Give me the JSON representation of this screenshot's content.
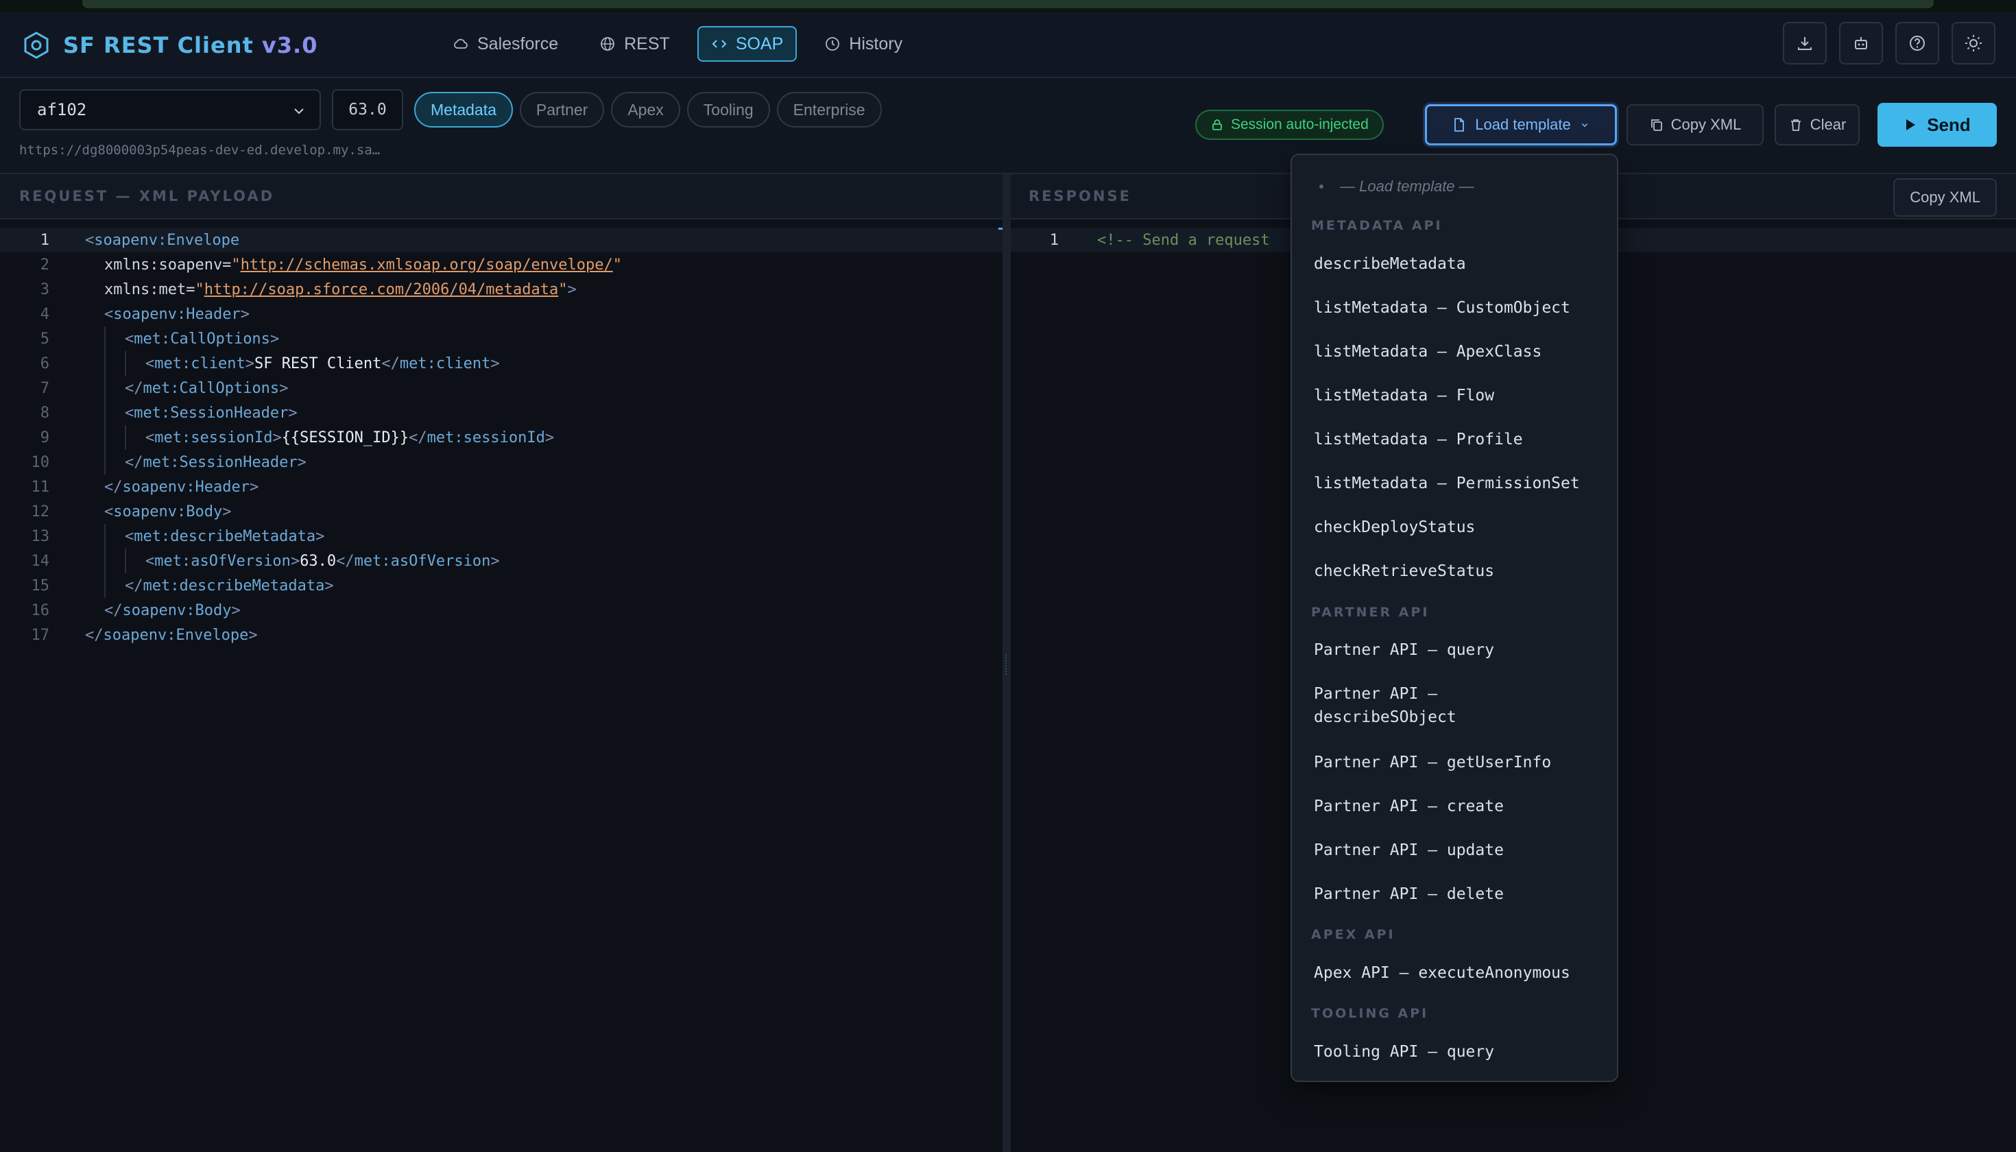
{
  "app": {
    "title_main": "SF REST Client",
    "title_version": "v3.0"
  },
  "nav": {
    "tabs": [
      {
        "label": "Salesforce",
        "icon": "cloud-icon"
      },
      {
        "label": "REST",
        "icon": "globe-icon"
      },
      {
        "label": "SOAP",
        "icon": "code-icon",
        "active": true
      },
      {
        "label": "History",
        "icon": "clock-icon"
      }
    ],
    "actions": [
      "download-icon",
      "robot-icon",
      "help-icon",
      "sun-icon"
    ]
  },
  "toolbar": {
    "org": "af102",
    "api_version": "63.0",
    "api_types": [
      "Metadata",
      "Partner",
      "Apex",
      "Tooling",
      "Enterprise"
    ],
    "active_api_type": "Metadata",
    "instance_url": "https://dg8000003p54peas-dev-ed.develop.my.sa…",
    "session_badge": "Session auto-injected",
    "load_template_label": "Load template",
    "copy_xml_label": "Copy XML",
    "clear_label": "Clear",
    "send_label": "Send"
  },
  "request": {
    "title": "Request — XML Payload",
    "line_numbers": [
      "1",
      "2",
      "3",
      "4",
      "5",
      "6",
      "7",
      "8",
      "9",
      "10",
      "11",
      "12",
      "13",
      "14",
      "15",
      "16",
      "17"
    ],
    "lines": {
      "l1": "soapenv:Envelope",
      "l2_attr": "xmlns:soapenv=",
      "l2_url": "http://schemas.xmlsoap.org/soap/envelope/",
      "l3_attr": "xmlns:met=",
      "l3_url": "http://soap.sforce.com/2006/04/metadata",
      "l4": "soapenv:Header",
      "l5": "met:CallOptions",
      "l6_open": "met:client",
      "l6_text": "SF REST Client",
      "l6_close": "met:client",
      "l7": "met:CallOptions",
      "l8": "met:SessionHeader",
      "l9_open": "met:sessionId",
      "l9_text": "{{SESSION_ID}}",
      "l9_close": "met:sessionId",
      "l10": "met:SessionHeader",
      "l11": "soapenv:Header",
      "l12": "soapenv:Body",
      "l13": "met:describeMetadata",
      "l14_open": "met:asOfVersion",
      "l14_text": "63.0",
      "l14_close": "met:asOfVersion",
      "l15": "met:describeMetadata",
      "l16": "soapenv:Body",
      "l17": "soapenv:Envelope"
    }
  },
  "response": {
    "title": "Response",
    "copy_xml_label": "Copy XML",
    "line_number": "1",
    "placeholder": "<!-- Send a request"
  },
  "template_dropdown": {
    "placeholder": "— Load template —",
    "groups": [
      {
        "label": "Metadata API",
        "items": [
          "describeMetadata",
          "listMetadata — CustomObject",
          "listMetadata — ApexClass",
          "listMetadata — Flow",
          "listMetadata — Profile",
          "listMetadata — PermissionSet",
          "checkDeployStatus",
          "checkRetrieveStatus"
        ]
      },
      {
        "label": "Partner API",
        "items": [
          "Partner API — query",
          "Partner API — describeSObject",
          "Partner API — getUserInfo",
          "Partner API — create",
          "Partner API — update",
          "Partner API — delete"
        ]
      },
      {
        "label": "Apex API",
        "items": [
          "Apex API — executeAnonymous"
        ]
      },
      {
        "label": "Tooling API",
        "items": [
          "Tooling API — query"
        ]
      }
    ]
  }
}
